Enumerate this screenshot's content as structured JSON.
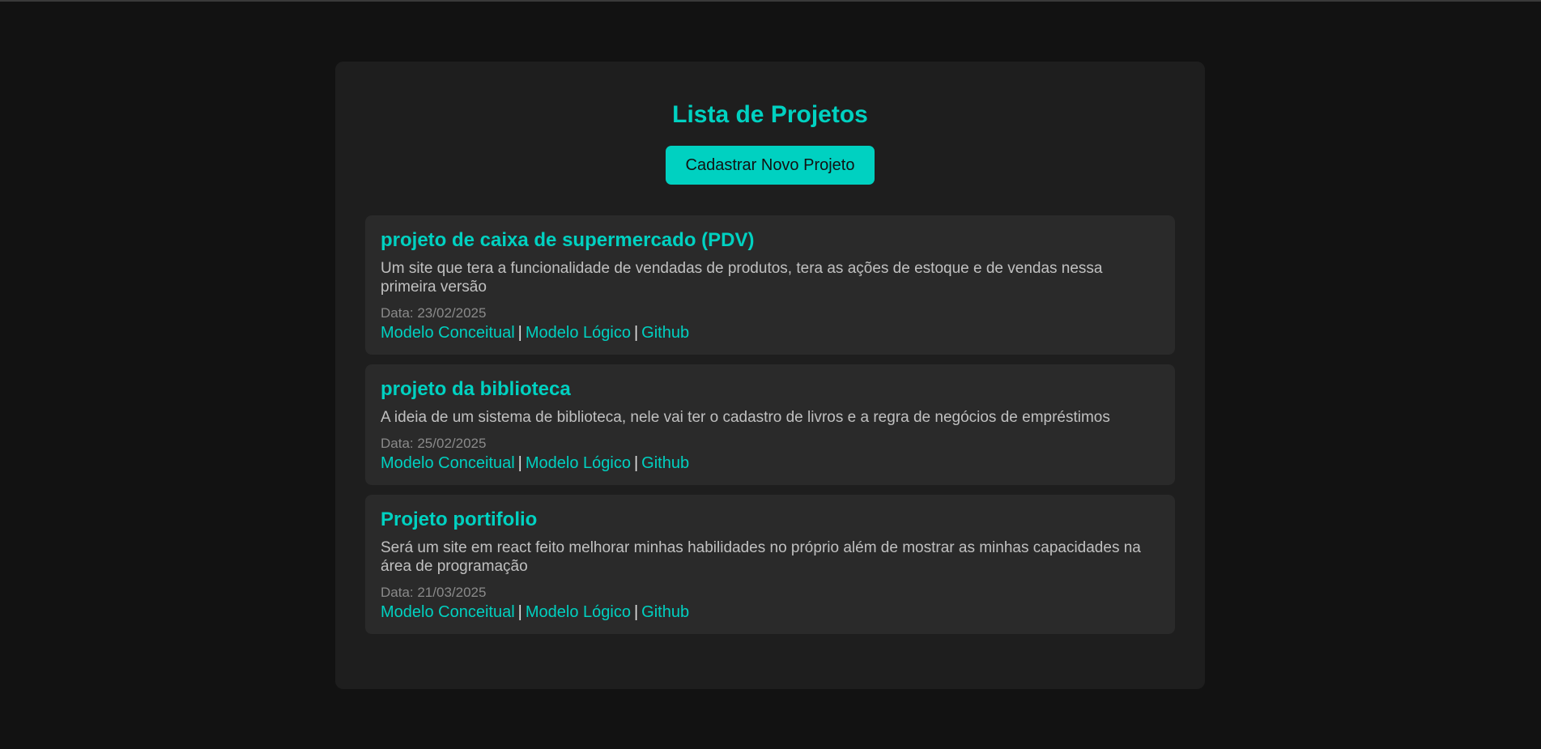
{
  "page": {
    "title": "Lista de Projetos",
    "new_project_button": "Cadastrar Novo Projeto"
  },
  "projects": [
    {
      "title": "projeto de caixa de supermercado (PDV)",
      "description": "Um site que tera a funcionalidade de vendadas de produtos, tera as ações de estoque e de vendas nessa primeira versão",
      "date": "Data: 23/02/2025",
      "links": {
        "conceptual": "Modelo Conceitual",
        "logical": "Modelo Lógico",
        "github": "Github"
      }
    },
    {
      "title": "projeto da biblioteca",
      "description": "A ideia de um sistema de biblioteca, nele vai ter o cadastro de livros e a regra de negócios de empréstimos",
      "date": "Data: 25/02/2025",
      "links": {
        "conceptual": "Modelo Conceitual",
        "logical": "Modelo Lógico",
        "github": "Github"
      }
    },
    {
      "title": "Projeto portifolio",
      "description": "Será um site em react feito melhorar minhas habilidades no próprio além de mostrar as minhas capacidades na área de programação",
      "date": "Data: 21/03/2025",
      "links": {
        "conceptual": "Modelo Conceitual",
        "logical": "Modelo Lógico",
        "github": "Github"
      }
    }
  ],
  "separator": "|",
  "colors": {
    "background": "#121212",
    "container": "#1e1e1e",
    "card": "#2a2a2a",
    "accent": "#00d1c1",
    "text": "#c0c0c0",
    "muted": "#8a8a8a"
  }
}
